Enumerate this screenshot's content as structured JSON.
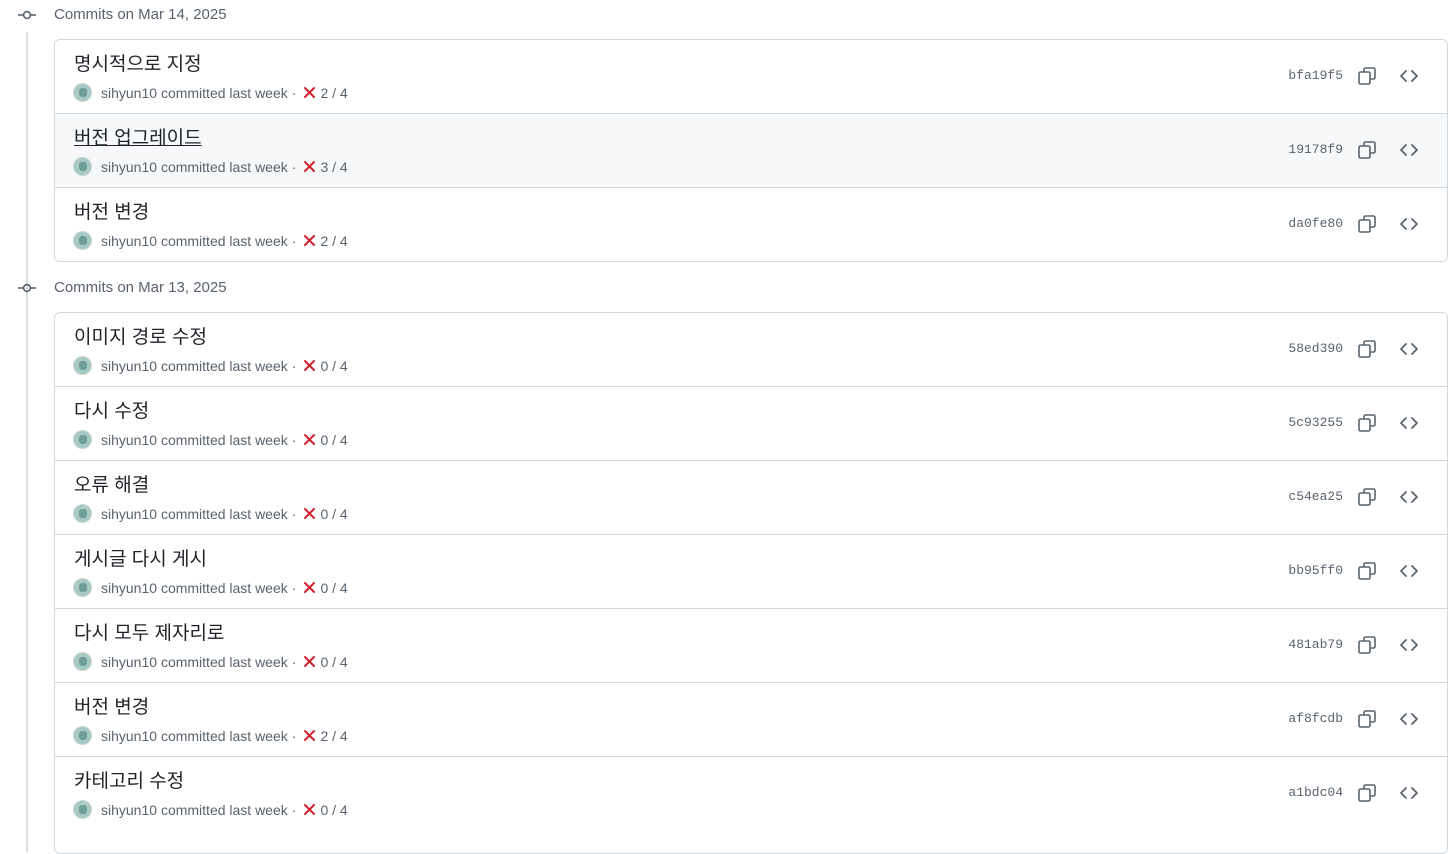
{
  "groups": [
    {
      "title": "Commits on Mar 14, 2025",
      "commits": [
        {
          "message": "명시적으로 지정",
          "author": "sihyun10",
          "when": "committed last week",
          "sep": "·",
          "checks": "2 / 4",
          "sha": "bfa19f5"
        },
        {
          "message": "버전 업그레이드",
          "author": "sihyun10",
          "when": "committed last week",
          "sep": "·",
          "checks": "3 / 4",
          "sha": "19178f9"
        },
        {
          "message": "버전 변경",
          "author": "sihyun10",
          "when": "committed last week",
          "sep": "·",
          "checks": "2 / 4",
          "sha": "da0fe80"
        }
      ]
    },
    {
      "title": "Commits on Mar 13, 2025",
      "commits": [
        {
          "message": "이미지 경로 수정",
          "author": "sihyun10",
          "when": "committed last week",
          "sep": "·",
          "checks": "0 / 4",
          "sha": "58ed390"
        },
        {
          "message": "다시 수정",
          "author": "sihyun10",
          "when": "committed last week",
          "sep": "·",
          "checks": "0 / 4",
          "sha": "5c93255"
        },
        {
          "message": "오류 해결",
          "author": "sihyun10",
          "when": "committed last week",
          "sep": "·",
          "checks": "0 / 4",
          "sha": "c54ea25"
        },
        {
          "message": "게시글 다시 게시",
          "author": "sihyun10",
          "when": "committed last week",
          "sep": "·",
          "checks": "0 / 4",
          "sha": "bb95ff0"
        },
        {
          "message": "다시 모두 제자리로",
          "author": "sihyun10",
          "when": "committed last week",
          "sep": "·",
          "checks": "0 / 4",
          "sha": "481ab79"
        },
        {
          "message": "버전 변경",
          "author": "sihyun10",
          "when": "committed last week",
          "sep": "·",
          "checks": "2 / 4",
          "sha": "af8fcdb"
        },
        {
          "message": "카테고리 수정",
          "author": "sihyun10",
          "when": "committed last week",
          "sep": "·",
          "checks": "0 / 4",
          "sha": "a1bdc04"
        }
      ]
    }
  ],
  "colors": {
    "fail": "#cf222e",
    "muted": "#59636e",
    "border": "#d1d9e0",
    "hover": "#f6f8fa"
  },
  "icons": {
    "group": "git-commit-icon",
    "status": "x-fail-icon",
    "copy": "copy-icon",
    "browse": "code-icon"
  }
}
